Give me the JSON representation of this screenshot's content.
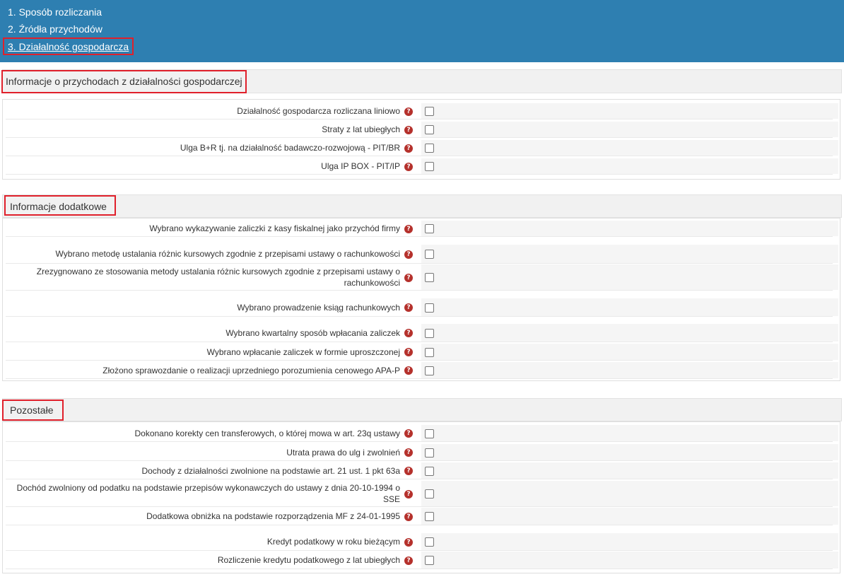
{
  "nav": {
    "items": [
      {
        "label": "1. Sposób rozliczania"
      },
      {
        "label": "2. Źródła przychodów"
      },
      {
        "label": "3. Działalność gospodarcza"
      }
    ]
  },
  "help_icon_glyph": "?",
  "sections": [
    {
      "title": "Informacje o przychodach z działalności gospodarczej",
      "rows": [
        {
          "label": "Działalność gospodarcza rozliczana liniowo",
          "checked": false
        },
        {
          "label": "Straty z lat ubiegłych",
          "checked": false
        },
        {
          "label": "Ulga B+R tj. na działalność badawczo-rozwojową - PIT/BR",
          "checked": false
        },
        {
          "label": "Ulga IP BOX - PIT/IP",
          "checked": false
        }
      ]
    },
    {
      "title": "Informacje dodatkowe",
      "rows": [
        {
          "label": "Wybrano wykazywanie zaliczki z kasy fiskalnej jako przychód firmy",
          "checked": false
        },
        {
          "label": "Wybrano metodę ustalania różnic kursowych zgodnie z przepisami ustawy o rachunkowości",
          "checked": false
        },
        {
          "label": "Zrezygnowano ze stosowania metody ustalania różnic kursowych zgodnie z przepisami ustawy o rachunkowości",
          "checked": false
        },
        {
          "label": "Wybrano prowadzenie ksiąg rachunkowych",
          "checked": false
        },
        {
          "label": "Wybrano kwartalny sposób wpłacania zaliczek",
          "checked": false
        },
        {
          "label": "Wybrano wpłacanie zaliczek w formie uproszczonej",
          "checked": false
        },
        {
          "label": "Złożono sprawozdanie o realizacji uprzedniego porozumienia cenowego APA-P",
          "checked": false
        }
      ]
    },
    {
      "title": "Pozostałe",
      "rows": [
        {
          "label": "Dokonano korekty cen transferowych, o której mowa w art. 23q ustawy",
          "checked": false
        },
        {
          "label": "Utrata prawa do ulg i zwolnień",
          "checked": false
        },
        {
          "label": "Dochody z działalności zwolnione na podstawie art. 21 ust. 1 pkt 63a",
          "checked": false
        },
        {
          "label": "Dochód zwolniony od podatku na podstawie przepisów wykonawczych do ustawy z dnia 20-10-1994 o SSE",
          "checked": false
        },
        {
          "label": "Dodatkowa obniżka na podstawie rozporządzenia MF z 24-01-1995",
          "checked": false
        },
        {
          "label": "Kredyt podatkowy w roku bieżącym",
          "checked": false
        },
        {
          "label": "Rozliczenie kredytu podatkowego z lat ubiegłych",
          "checked": false
        }
      ]
    }
  ],
  "colors": {
    "header_bg": "#2e7fb1",
    "highlight": "#e0202b",
    "help_icon": "#b5312c"
  }
}
